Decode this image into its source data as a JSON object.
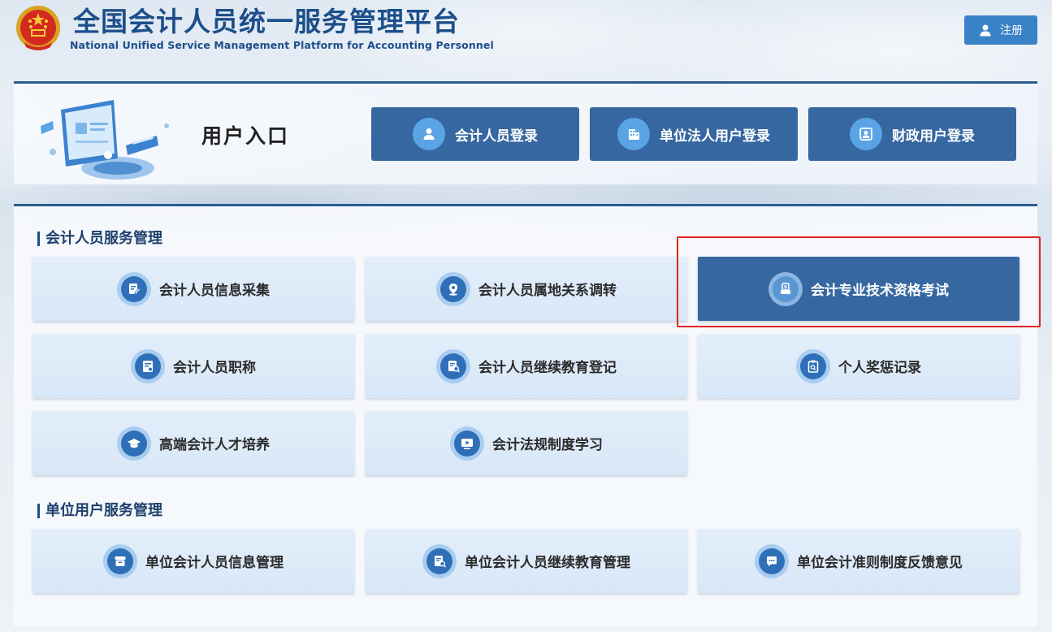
{
  "header": {
    "title": "全国会计人员统一服务管理平台",
    "subtitle": "National Unified Service Management Platform for Accounting Personnel",
    "register_label": "注册"
  },
  "entry": {
    "title": "用户入口",
    "buttons": [
      {
        "label": "会计人员登录",
        "icon": "person-icon"
      },
      {
        "label": "单位法人用户登录",
        "icon": "building-icon"
      },
      {
        "label": "财政用户登录",
        "icon": "portrait-icon"
      }
    ]
  },
  "sections": [
    {
      "title": "会计人员服务管理",
      "cards": [
        {
          "label": "会计人员信息采集",
          "icon": "edit-form-icon"
        },
        {
          "label": "会计人员属地关系调转",
          "icon": "location-pin-icon"
        },
        {
          "label": "会计专业技术资格考试",
          "icon": "exam-document-icon",
          "active": true
        },
        {
          "label": "会计人员职称",
          "icon": "certificate-icon"
        },
        {
          "label": "会计人员继续教育登记",
          "icon": "document-search-icon"
        },
        {
          "label": "个人奖惩记录",
          "icon": "clipboard-search-icon"
        },
        {
          "label": "高端会计人才培养",
          "icon": "graduation-cap-icon"
        },
        {
          "label": "会计法规制度学习",
          "icon": "video-play-icon"
        }
      ]
    },
    {
      "title": "单位用户服务管理",
      "cards": [
        {
          "label": "单位会计人员信息管理",
          "icon": "archive-box-icon"
        },
        {
          "label": "单位会计人员继续教育管理",
          "icon": "document-search-icon"
        },
        {
          "label": "单位会计准则制度反馈意见",
          "icon": "chat-bubble-icon"
        }
      ]
    }
  ],
  "colors": {
    "primary": "#3667a0",
    "title_blue": "#1c4e8a",
    "card_bg": "#dde9f8",
    "highlight": "#e02424"
  }
}
